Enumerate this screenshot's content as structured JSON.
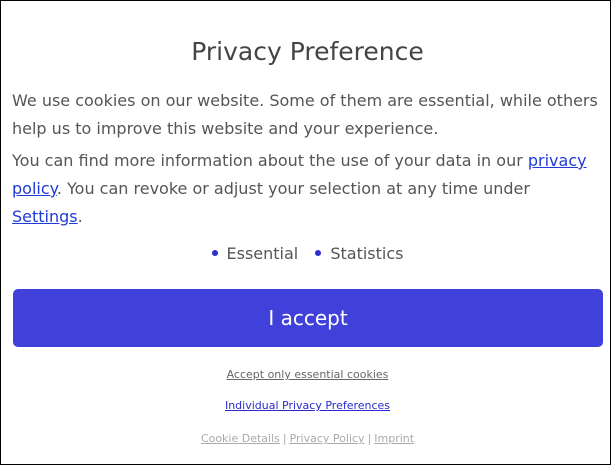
{
  "dialog": {
    "title": "Privacy Preference",
    "intro": "We use cookies on our website. Some of them are essential, while others help us to improve this website and your experience.",
    "info_prefix": "You can find more information about the use of your data in our ",
    "privacy_link": "privacy policy",
    "info_middle": ". You can revoke or adjust your selection at any time under ",
    "settings_link": "Settings",
    "info_suffix": ".",
    "groups": [
      "Essential",
      "Statistics"
    ],
    "accept_label": "I accept",
    "accept_essential_label": "Accept only essential cookies",
    "individual_prefs_label": "Individual Privacy Preferences",
    "footer": {
      "cookie_details": "Cookie Details",
      "privacy_policy": "Privacy Policy",
      "imprint": "Imprint",
      "separator": "|"
    }
  },
  "colors": {
    "accent": "#4040db",
    "link": "#1f3bd6",
    "text": "#555555",
    "muted": "#aaaaaa"
  }
}
